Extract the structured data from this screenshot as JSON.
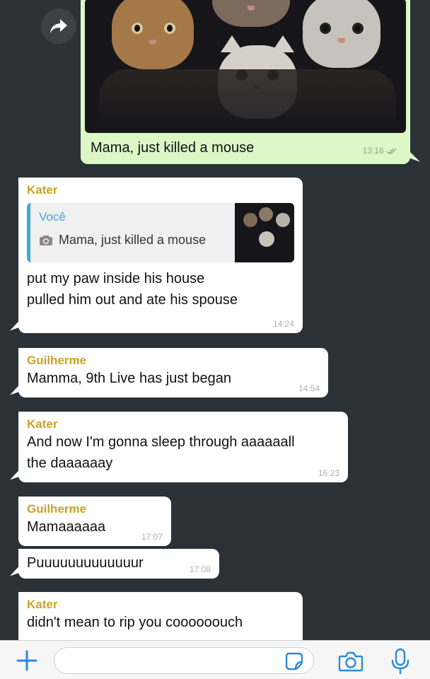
{
  "outgoing": {
    "caption": "Mama, just killed a mouse",
    "time": "13:16"
  },
  "messages": [
    {
      "sender": "Kater",
      "quote_name": "Você",
      "quote_text": "Mama, just killed a mouse",
      "lines": [
        "put my paw inside his house",
        "pulled him out and ate his spouse"
      ],
      "time": "14:24"
    },
    {
      "sender": "Guilherme",
      "lines": [
        "Mamma, 9th Live has just began"
      ],
      "time": "14:54"
    },
    {
      "sender": "Kater",
      "lines": [
        "And now I'm gonna sleep through aaaaaall",
        "the daaaaaay"
      ],
      "time": "16:23"
    },
    {
      "sender": "Guilherme",
      "lines": [
        "Mamaaaaaa"
      ],
      "time": "17:07"
    },
    {
      "lines": [
        "Puuuuuuuuuuuuur"
      ],
      "time": "17:08"
    },
    {
      "sender": "Kater",
      "lines": [
        "didn't mean to rip you coooooouch"
      ]
    }
  ],
  "colors": {
    "background": "#2b3237",
    "outgoing_bubble": "#dcf8c6",
    "incoming_bubble": "#ffffff",
    "sender_name": "#c9a227",
    "quote_accent": "#3fa8d6"
  },
  "icons": [
    "forward-icon",
    "double-check-icon",
    "camera-small-icon",
    "plus-icon",
    "sticker-icon",
    "camera-icon",
    "microphone-icon"
  ]
}
